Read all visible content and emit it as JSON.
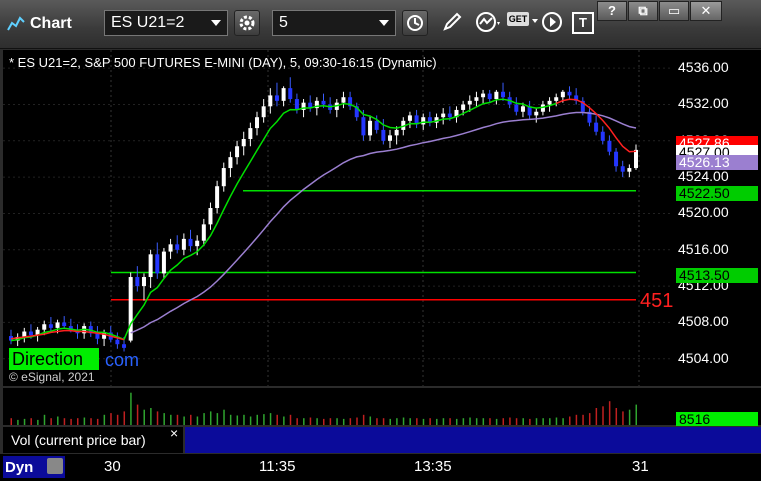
{
  "window": {
    "title": "Chart",
    "symbol": "ES U21=2",
    "interval": "5",
    "buttons": [
      "?",
      "⧉",
      "▭",
      "✕"
    ],
    "get_label": "GET",
    "t_label": "T"
  },
  "chart": {
    "header": "* ES U21=2, S&P 500 FUTURES E-MINI (DAY), 5, 09:30-16:15 (Dynamic)",
    "direction_label": "Direction",
    "com_label": "com",
    "copyright": "© eSignal, 2021",
    "right_edge_label": "451",
    "price_ticks": [
      "4536.00",
      "4532.00",
      "4528.00",
      "4524.00",
      "4520.00",
      "4516.00",
      "4512.00",
      "4508.00",
      "4504.00"
    ],
    "price_labels": [
      {
        "text": "4527.86",
        "color": "#ff0000",
        "fg": "#ffffff"
      },
      {
        "text": "4527.00",
        "color": "#ffffff",
        "fg": "#000000"
      },
      {
        "text": "4526.13",
        "color": "#9b7fd0",
        "fg": "#ffffff"
      },
      {
        "text": "4522.50",
        "color": "#00cc00",
        "fg": "#000000"
      },
      {
        "text": "4513.50",
        "color": "#00cc00",
        "fg": "#000000"
      }
    ],
    "horizontal_lines": [
      {
        "price": 4522.5,
        "color": "#00e000"
      },
      {
        "price": 4513.5,
        "color": "#00e000"
      },
      {
        "price": 4510.5,
        "color": "#ff0000"
      }
    ],
    "time_ticks": [
      "30",
      "11:35",
      "13:35",
      "31"
    ],
    "volume_label": "8516"
  },
  "status": {
    "vol_label": "Vol (current price bar)",
    "close_x": "×",
    "dyn_label": "Dyn"
  },
  "chart_data": {
    "type": "candlestick",
    "ylim": [
      4501,
      4538
    ],
    "candles": [
      [
        4506.5,
        4507.2,
        4505.6,
        4506.0
      ],
      [
        4506.0,
        4506.8,
        4505.4,
        4506.4
      ],
      [
        4506.4,
        4507.4,
        4505.8,
        4507.0
      ],
      [
        4507.0,
        4507.8,
        4506.2,
        4506.6
      ],
      [
        4506.6,
        4507.5,
        4505.9,
        4507.2
      ],
      [
        4507.2,
        4508.2,
        4506.6,
        4507.8
      ],
      [
        4507.8,
        4508.6,
        4507.0,
        4507.4
      ],
      [
        4507.4,
        4508.3,
        4506.8,
        4508.0
      ],
      [
        4508.0,
        4508.7,
        4507.3,
        4507.6
      ],
      [
        4507.6,
        4508.4,
        4506.9,
        4507.0
      ],
      [
        4507.0,
        4507.8,
        4506.2,
        4506.8
      ],
      [
        4506.8,
        4507.9,
        4506.2,
        4507.6
      ],
      [
        4507.6,
        4508.1,
        4506.4,
        4506.8
      ],
      [
        4506.8,
        4507.6,
        4505.6,
        4506.2
      ],
      [
        4506.2,
        4507.2,
        4505.4,
        4506.9
      ],
      [
        4506.9,
        4507.6,
        4505.8,
        4506.1
      ],
      [
        4506.1,
        4506.9,
        4505.1,
        4505.6
      ],
      [
        4505.6,
        4506.4,
        4504.8,
        4505.2
      ],
      [
        4506.0,
        4513.5,
        4505.8,
        4513.0
      ],
      [
        4513.0,
        4514.2,
        4511.4,
        4512.0
      ],
      [
        4512.0,
        4513.4,
        4510.4,
        4513.0
      ],
      [
        4513.0,
        4516.0,
        4511.8,
        4515.5
      ],
      [
        4515.5,
        4516.8,
        4512.8,
        4513.4
      ],
      [
        4513.4,
        4516.2,
        4512.9,
        4515.8
      ],
      [
        4515.8,
        4517.2,
        4515.0,
        4516.6
      ],
      [
        4516.6,
        4517.6,
        4515.6,
        4516.0
      ],
      [
        4516.0,
        4517.8,
        4515.4,
        4517.2
      ],
      [
        4517.2,
        4518.2,
        4515.8,
        4516.4
      ],
      [
        4516.4,
        4517.6,
        4515.4,
        4517.0
      ],
      [
        4517.0,
        4519.4,
        4516.4,
        4518.8
      ],
      [
        4518.8,
        4521.2,
        4518.2,
        4520.6
      ],
      [
        4520.6,
        4523.6,
        4520.0,
        4523.0
      ],
      [
        4523.0,
        4525.6,
        4522.4,
        4525.0
      ],
      [
        4525.0,
        4526.8,
        4524.0,
        4526.2
      ],
      [
        4526.2,
        4528.0,
        4525.4,
        4527.4
      ],
      [
        4527.4,
        4529.0,
        4526.4,
        4528.2
      ],
      [
        4528.2,
        4530.0,
        4527.4,
        4529.4
      ],
      [
        4529.4,
        4531.2,
        4528.6,
        4530.6
      ],
      [
        4530.6,
        4532.6,
        4530.0,
        4531.8
      ],
      [
        4531.8,
        4533.8,
        4531.0,
        4533.0
      ],
      [
        4533.0,
        4534.4,
        4531.8,
        4532.4
      ],
      [
        4532.4,
        4534.0,
        4531.8,
        4533.8
      ],
      [
        4533.8,
        4535.0,
        4532.2,
        4532.6
      ],
      [
        4532.6,
        4533.2,
        4531.0,
        4531.4
      ],
      [
        4531.4,
        4532.6,
        4530.6,
        4532.2
      ],
      [
        4532.2,
        4533.0,
        4531.2,
        4531.6
      ],
      [
        4531.6,
        4532.8,
        4530.8,
        4532.4
      ],
      [
        4532.4,
        4533.2,
        4531.6,
        4532.0
      ],
      [
        4532.0,
        4532.8,
        4531.0,
        4531.4
      ],
      [
        4531.4,
        4532.6,
        4530.6,
        4532.2
      ],
      [
        4532.2,
        4533.4,
        4531.6,
        4532.8
      ],
      [
        4532.8,
        4533.4,
        4531.4,
        4531.8
      ],
      [
        4531.8,
        4532.2,
        4530.2,
        4530.6
      ],
      [
        4530.6,
        4531.4,
        4528.0,
        4528.6
      ],
      [
        4528.6,
        4530.8,
        4528.0,
        4530.2
      ],
      [
        4530.2,
        4530.8,
        4528.8,
        4529.2
      ],
      [
        4529.2,
        4530.4,
        4527.6,
        4528.0
      ],
      [
        4528.0,
        4529.2,
        4527.2,
        4528.6
      ],
      [
        4528.6,
        4529.6,
        4527.6,
        4529.2
      ],
      [
        4529.2,
        4530.6,
        4528.6,
        4530.2
      ],
      [
        4530.2,
        4531.2,
        4529.4,
        4530.8
      ],
      [
        4530.8,
        4531.4,
        4529.4,
        4529.8
      ],
      [
        4529.8,
        4531.0,
        4529.2,
        4530.6
      ],
      [
        4530.6,
        4531.2,
        4529.6,
        4530.0
      ],
      [
        4530.0,
        4531.0,
        4529.4,
        4530.6
      ],
      [
        4530.6,
        4531.6,
        4529.8,
        4531.0
      ],
      [
        4531.0,
        4531.8,
        4530.2,
        4530.6
      ],
      [
        4530.6,
        4531.8,
        4530.0,
        4531.4
      ],
      [
        4531.4,
        4532.4,
        4530.8,
        4532.0
      ],
      [
        4532.0,
        4533.0,
        4531.2,
        4532.4
      ],
      [
        4532.4,
        4533.4,
        4531.8,
        4532.8
      ],
      [
        4532.8,
        4533.6,
        4532.0,
        4533.2
      ],
      [
        4533.2,
        4533.6,
        4532.2,
        4532.6
      ],
      [
        4532.6,
        4533.6,
        4532.0,
        4533.4
      ],
      [
        4533.4,
        4534.4,
        4532.4,
        4532.8
      ],
      [
        4532.8,
        4533.4,
        4531.6,
        4532.0
      ],
      [
        4532.0,
        4532.8,
        4530.8,
        4531.2
      ],
      [
        4531.2,
        4532.2,
        4530.6,
        4531.8
      ],
      [
        4531.8,
        4532.4,
        4530.4,
        4530.8
      ],
      [
        4530.8,
        4531.6,
        4530.0,
        4531.2
      ],
      [
        4531.2,
        4532.4,
        4530.8,
        4532.0
      ],
      [
        4532.0,
        4532.8,
        4531.2,
        4532.4
      ],
      [
        4532.4,
        4533.2,
        4531.8,
        4532.8
      ],
      [
        4532.8,
        4533.6,
        4532.2,
        4533.4
      ],
      [
        4533.4,
        4534.0,
        4532.6,
        4533.0
      ],
      [
        4533.0,
        4533.8,
        4532.0,
        4532.4
      ],
      [
        4532.4,
        4532.8,
        4530.8,
        4531.2
      ],
      [
        4531.2,
        4531.8,
        4529.6,
        4530.0
      ],
      [
        4530.0,
        4530.8,
        4528.6,
        4529.0
      ],
      [
        4529.0,
        4529.6,
        4527.6,
        4528.0
      ],
      [
        4528.0,
        4528.6,
        4526.4,
        4526.8
      ],
      [
        4526.8,
        4527.2,
        4524.6,
        4525.2
      ],
      [
        4525.2,
        4525.8,
        4524.0,
        4524.6
      ],
      [
        4524.6,
        4525.4,
        4524.0,
        4525.0
      ],
      [
        4525.0,
        4527.6,
        4524.8,
        4527.0
      ]
    ],
    "ma_red": [
      4506.2,
      4506.3,
      4506.4,
      4506.5,
      4506.6,
      4506.7,
      4506.9,
      4507.0,
      4507.1,
      4507.1,
      4507.0,
      4507.0,
      4506.9,
      4506.8,
      4506.7,
      4506.5,
      4506.3,
      4506.1
    ],
    "volume": [
      0.2,
      0.15,
      0.18,
      0.2,
      0.15,
      0.3,
      0.2,
      0.25,
      0.2,
      0.18,
      0.2,
      0.22,
      0.2,
      0.18,
      0.3,
      0.35,
      0.3,
      0.4,
      0.95,
      0.6,
      0.45,
      0.5,
      0.4,
      0.35,
      0.3,
      0.3,
      0.25,
      0.3,
      0.25,
      0.35,
      0.4,
      0.35,
      0.45,
      0.3,
      0.28,
      0.3,
      0.25,
      0.3,
      0.32,
      0.35,
      0.3,
      0.25,
      0.3,
      0.2,
      0.2,
      0.22,
      0.2,
      0.18,
      0.2,
      0.2,
      0.18,
      0.2,
      0.22,
      0.3,
      0.25,
      0.2,
      0.2,
      0.18,
      0.2,
      0.22,
      0.2,
      0.2,
      0.18,
      0.2,
      0.18,
      0.2,
      0.2,
      0.18,
      0.2,
      0.22,
      0.2,
      0.2,
      0.2,
      0.18,
      0.2,
      0.22,
      0.2,
      0.2,
      0.18,
      0.2,
      0.2,
      0.2,
      0.22,
      0.2,
      0.25,
      0.3,
      0.3,
      0.35,
      0.5,
      0.55,
      0.7,
      0.5,
      0.4,
      0.45,
      0.6
    ]
  }
}
